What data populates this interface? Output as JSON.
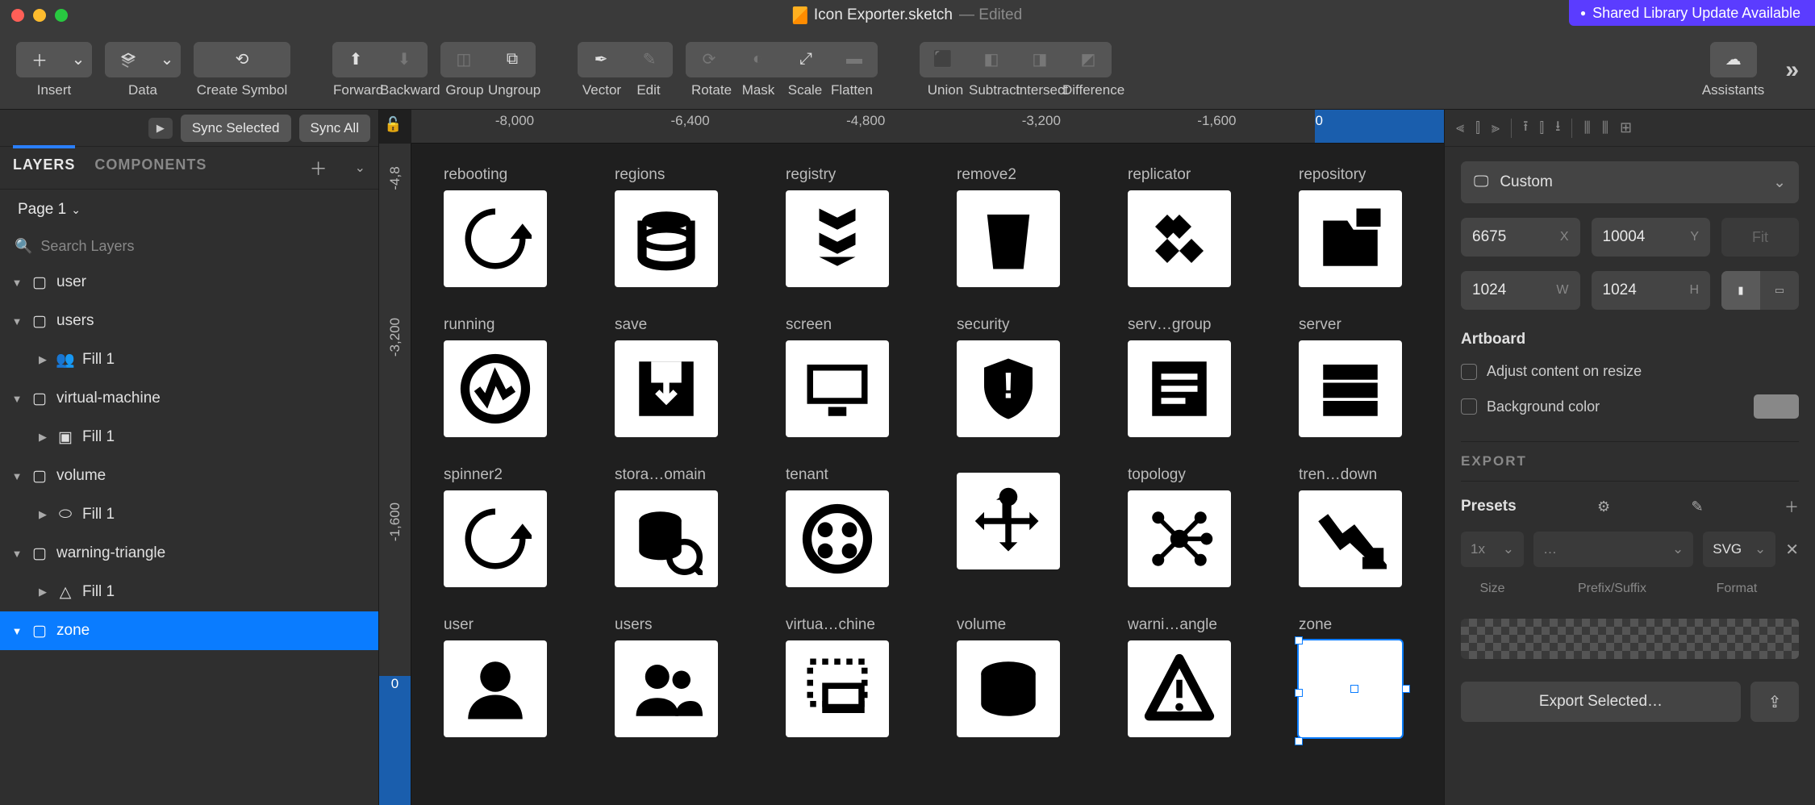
{
  "title": {
    "filename": "Icon Exporter.sketch",
    "status": "— Edited"
  },
  "shared_library": "Shared Library Update Available",
  "toolbar": {
    "insert": "Insert",
    "data": "Data",
    "create_symbol": "Create Symbol",
    "forward": "Forward",
    "backward": "Backward",
    "group": "Group",
    "ungroup": "Ungroup",
    "vector": "Vector",
    "edit": "Edit",
    "rotate": "Rotate",
    "mask": "Mask",
    "scale": "Scale",
    "flatten": "Flatten",
    "union": "Union",
    "subtract": "Subtract",
    "intersect": "Intersect",
    "difference": "Difference",
    "assistants": "Assistants"
  },
  "left": {
    "sync_selected": "Sync Selected",
    "sync_all": "Sync All",
    "tab_layers": "LAYERS",
    "tab_components": "COMPONENTS",
    "page": "Page 1",
    "search_placeholder": "Search Layers",
    "layers": [
      {
        "name": "user",
        "type": "artboard",
        "expanded": true
      },
      {
        "name": "users",
        "type": "artboard",
        "expanded": true,
        "children": [
          {
            "name": "Fill 1",
            "type": "group"
          }
        ]
      },
      {
        "name": "virtual-machine",
        "type": "artboard",
        "expanded": true,
        "children": [
          {
            "name": "Fill 1",
            "type": "shape"
          }
        ]
      },
      {
        "name": "volume",
        "type": "artboard",
        "expanded": true,
        "children": [
          {
            "name": "Fill 1",
            "type": "cylinder"
          }
        ]
      },
      {
        "name": "warning-triangle",
        "type": "artboard",
        "expanded": true,
        "children": [
          {
            "name": "Fill 1",
            "type": "triangle"
          }
        ]
      },
      {
        "name": "zone",
        "type": "artboard",
        "selected": true
      }
    ]
  },
  "ruler": {
    "h": [
      "-8,000",
      "-6,400",
      "-4,800",
      "-3,200",
      "-1,600",
      "0"
    ],
    "v": [
      "-4,8",
      "-3,200",
      "-1,600",
      "0"
    ]
  },
  "canvas": {
    "artboards": [
      "rebooting",
      "regions",
      "registry",
      "remove2",
      "replicator",
      "repository",
      "running",
      "save",
      "screen",
      "security",
      "serv…group",
      "server",
      "spinner2",
      "stora…omain",
      "tenant",
      "",
      "topology",
      "tren…down",
      "user",
      "users",
      "virtua…chine",
      "volume",
      "warni…angle",
      "zone"
    ],
    "selected": "zone"
  },
  "inspector": {
    "preset": "Custom",
    "x": "6675",
    "y": "10004",
    "w": "1024",
    "h": "1024",
    "fit": "Fit",
    "section_artboard": "Artboard",
    "adjust_resize": "Adjust content on resize",
    "background_color": "Background color",
    "section_export": "EXPORT",
    "presets": "Presets",
    "size": "1x",
    "prefix": "…",
    "format": "SVG",
    "label_size": "Size",
    "label_prefix": "Prefix/Suffix",
    "label_format": "Format",
    "export_btn": "Export Selected…"
  }
}
